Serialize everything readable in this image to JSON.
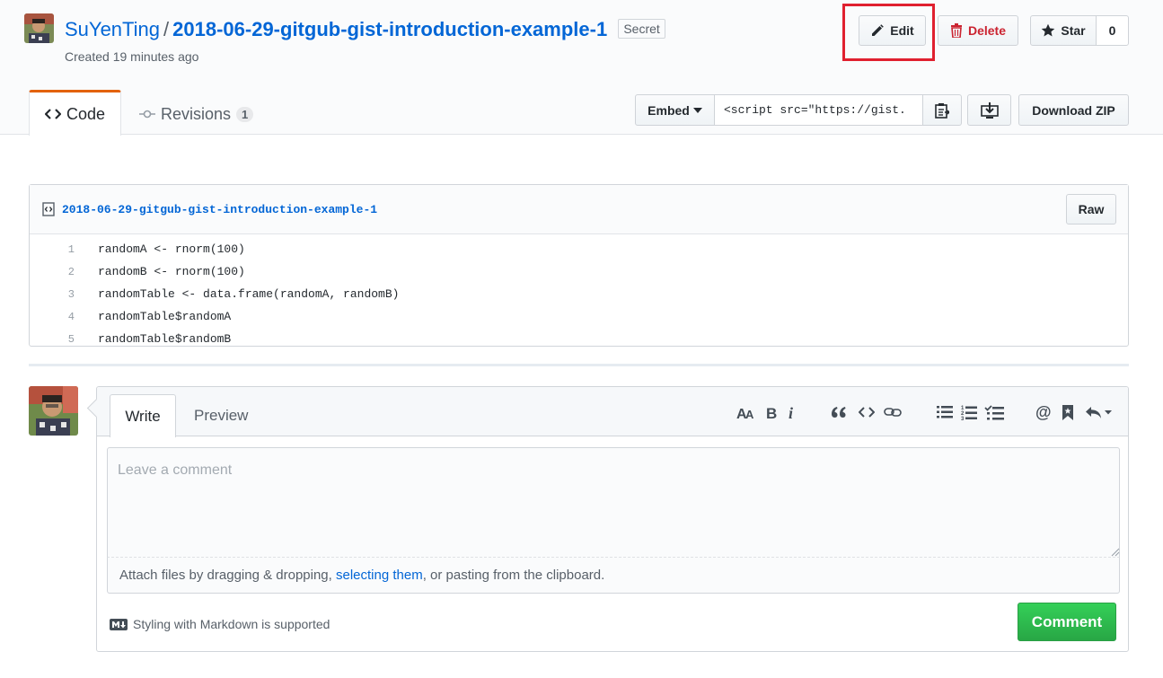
{
  "header": {
    "owner": "SuYenTing",
    "separator": "/",
    "gist_name": "2018-06-29-gitgub-gist-introduction-example-1",
    "visibility_badge": "Secret",
    "created_text": "Created 19 minutes ago",
    "edit_label": "Edit",
    "delete_label": "Delete",
    "star_label": "Star",
    "star_count": "0"
  },
  "tabs": {
    "code_label": "Code",
    "revisions_label": "Revisions",
    "revisions_count": "1"
  },
  "embed": {
    "label": "Embed",
    "value": "<script src=\"https://gist.",
    "download_zip_label": "Download ZIP"
  },
  "file": {
    "name": "2018-06-29-gitgub-gist-introduction-example-1",
    "raw_label": "Raw",
    "lines": [
      {
        "num": "1",
        "code": "randomA <- rnorm(100)"
      },
      {
        "num": "2",
        "code": "randomB <- rnorm(100)"
      },
      {
        "num": "3",
        "code": "randomTable <- data.frame(randomA, randomB)"
      },
      {
        "num": "4",
        "code": "randomTable$randomA"
      },
      {
        "num": "5",
        "code": "randomTable$randomB"
      }
    ]
  },
  "comment": {
    "write_tab": "Write",
    "preview_tab": "Preview",
    "placeholder": "Leave a comment",
    "drop_hint_before": "Attach files by dragging & dropping, ",
    "drop_hint_link": "selecting them",
    "drop_hint_after": ", or pasting from the clipboard.",
    "markdown_note": "Styling with Markdown is supported",
    "submit_label": "Comment",
    "toolbar_icons": [
      "text-size-icon",
      "bold-icon",
      "italic-icon",
      "quote-icon",
      "code-icon",
      "link-icon",
      "bulleted-list-icon",
      "numbered-list-icon",
      "task-list-icon",
      "mention-icon",
      "bookmark-icon",
      "reply-icon"
    ]
  },
  "colors": {
    "link": "#0366d6",
    "active_tab_accent": "#e36209",
    "delete_red": "#cb2431",
    "highlight_outline": "#e0202f",
    "comment_green": "#28a745"
  }
}
